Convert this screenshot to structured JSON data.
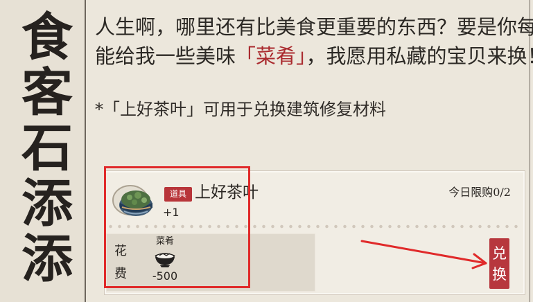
{
  "left_panel": {
    "title_chars": [
      "食",
      "客",
      "石",
      "添",
      "添"
    ]
  },
  "dialogue": {
    "line1": "人生啊，哪里还有比美食更重要的东西？要是你每日",
    "line2_before": "能给我一些美味",
    "line2_accent": "「菜肴」",
    "line2_after": "，我愿用私藏的宝贝来换！",
    "note": "*「上好茶叶」可用于兑换建筑修复材料"
  },
  "shop_item": {
    "icon_name": "tea-leaves-icon",
    "tag": "道具",
    "name": "上好茶叶",
    "amount": "+1",
    "limit": "今日限购0/2"
  },
  "cost": {
    "label_chars": [
      "花",
      "费"
    ],
    "item_name": "菜肴",
    "icon_name": "dish-bowl-icon",
    "value": "-500"
  },
  "button": {
    "chars": [
      "兑",
      "换"
    ]
  },
  "annotations": {
    "highlight_color": "#e02a2a",
    "arrow_color": "#e02a2a"
  },
  "colors": {
    "background": "#ece7dc",
    "card": "#f1ede4",
    "accent": "#aa2b2f",
    "button": "#b7373d"
  }
}
